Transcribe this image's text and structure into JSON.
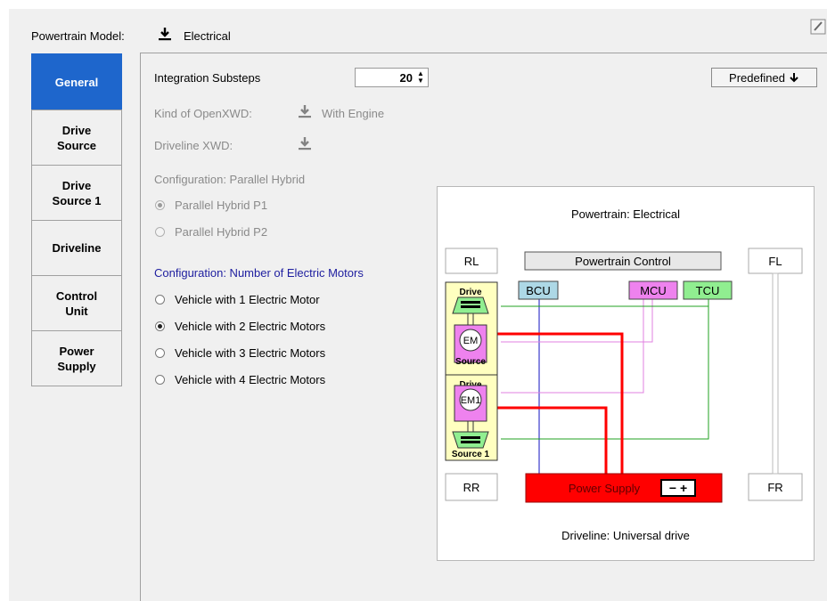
{
  "header": {
    "model_label": "Powertrain Model:",
    "model_value": "Electrical"
  },
  "tabs": [
    {
      "label": "General"
    },
    {
      "label": "Drive\nSource"
    },
    {
      "label": "Drive\nSource 1"
    },
    {
      "label": "Driveline"
    },
    {
      "label": "Control\nUnit"
    },
    {
      "label": "Power\nSupply"
    }
  ],
  "general": {
    "substeps_label": "Integration Substeps",
    "substeps_value": "20",
    "predefined_label": "Predefined",
    "openxwd_label": "Kind of OpenXWD:",
    "openxwd_value": "With Engine",
    "driveline_xwd_label": "Driveline XWD:",
    "config_hybrid_label": "Configuration: Parallel Hybrid",
    "hybrid_options": [
      "Parallel Hybrid P1",
      "Parallel Hybrid P2"
    ],
    "config_motors_label": "Configuration: Number of Electric Motors",
    "motor_options": [
      "Vehicle with 1 Electric Motor",
      "Vehicle with 2 Electric Motors",
      "Vehicle with 3 Electric Motors",
      "Vehicle with 4 Electric Motors"
    ]
  },
  "diagram": {
    "title": "Powertrain: Electrical",
    "footer": "Driveline: Universal drive",
    "wheels": {
      "rl": "RL",
      "fl": "FL",
      "rr": "RR",
      "fr": "FR"
    },
    "control": "Powertrain Control",
    "bcu": "BCU",
    "mcu": "MCU",
    "tcu": "TCU",
    "drive_top": "Drive",
    "source_top": "Source",
    "em": "EM",
    "drive_bottom": "Drive",
    "em1": "EM1",
    "source_bottom": "Source 1",
    "power_supply": "Power Supply",
    "battery": "− +"
  },
  "colors": {
    "tab_active": "#1e66cc",
    "power_supply": "#ff0000",
    "bcu_fill": "#add8e6",
    "mcu_fill": "#ee82ee",
    "tcu_fill": "#90ee90",
    "source_fill": "#ffffc0"
  }
}
